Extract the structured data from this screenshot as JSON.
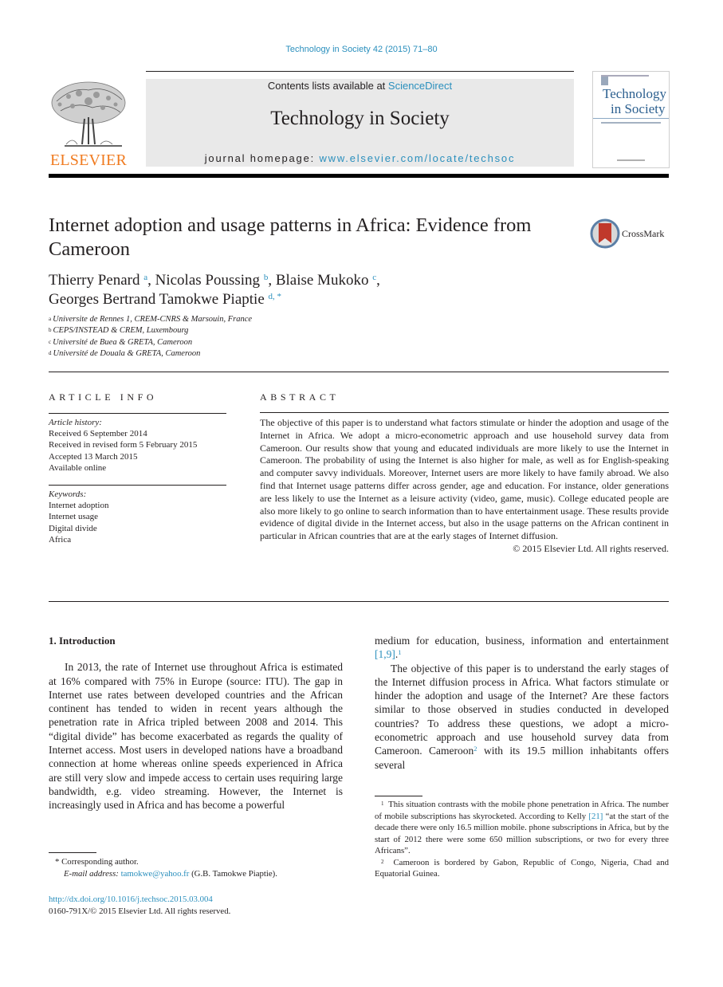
{
  "running_head": "Technology in Society 42 (2015) 71–80",
  "publisher": {
    "name": "ELSEVIER",
    "logo_icon": "elsevier-tree-logo"
  },
  "masthead": {
    "contents_prefix": "Contents lists available at ",
    "contents_link": "ScienceDirect",
    "journal_title": "Technology in Society",
    "homepage_prefix": "journal homepage: ",
    "homepage_link": "www.elsevier.com/locate/techsoc"
  },
  "cover": {
    "line1": "Technology",
    "line2": "in Society"
  },
  "article": {
    "title": "Internet adoption and usage patterns in Africa: Evidence from Cameroon",
    "crossmark_label": "CrossMark",
    "authors": [
      {
        "name": "Thierry Penard",
        "sup": "a",
        "sep": ", "
      },
      {
        "name": "Nicolas Poussing",
        "sup": "b",
        "sep": ", "
      },
      {
        "name": "Blaise Mukoko",
        "sup": "c",
        "sep": ","
      },
      {
        "name": "Georges Bertrand Tamokwe Piaptie",
        "sup": "d, *",
        "sep": ""
      }
    ],
    "affiliations": [
      {
        "sup": "a",
        "text": "Universite de Rennes 1, CREM-CNRS & Marsouin, France"
      },
      {
        "sup": "b",
        "text": "CEPS/INSTEAD & CREM, Luxembourg"
      },
      {
        "sup": "c",
        "text": "Université de Buea & GRETA, Cameroon"
      },
      {
        "sup": "d",
        "text": "Université de Douala & GRETA, Cameroon"
      }
    ]
  },
  "article_info": {
    "heading": "ARTICLE INFO",
    "history_label": "Article history:",
    "history": [
      "Received 6 September 2014",
      "Received in revised form 5 February 2015",
      "Accepted 13 March 2015",
      "Available online"
    ],
    "keywords_label": "Keywords:",
    "keywords": [
      "Internet adoption",
      "Internet usage",
      "Digital divide",
      "Africa"
    ]
  },
  "abstract": {
    "heading": "ABSTRACT",
    "text": "The objective of this paper is to understand what factors stimulate or hinder the adoption and usage of the Internet in Africa. We adopt a micro-econometric approach and use household survey data from Cameroon. Our results show that young and educated individuals are more likely to use the Internet in Cameroon. The probability of using the Internet is also higher for male, as well as for English-speaking and computer savvy individuals. Moreover, Internet users are more likely to have family abroad. We also find that Internet usage patterns differ across gender, age and education. For instance, older generations are less likely to use the Internet as a leisure activity (video, game, music). College educated people are also more likely to go online to search in­formation than to have entertainment usage. These results provide evidence of digital divide in the Internet access, but also in the usage patterns on the African continent in particular in African countries that are at the early stages of Internet diffusion.",
    "copyright": "© 2015 Elsevier Ltd. All rights reserved."
  },
  "intro": {
    "heading": "1.  Introduction",
    "p1": "In 2013, the rate of Internet use throughout Africa is estimated at 16% compared with 75% in Europe (source: ITU). The gap in Internet use rates between developed countries and the African continent has tended to widen in recent years although the penetration rate in Africa tripled between 2008 and 2014. This “digital divide” has become exacerbated as regards the quality of Internet access. Most users in developed nations have a broadband connection at home whereas online speeds experienced in Africa are still very slow and impede access to certain uses requiring large bandwidth, e.g. video streaming. However, the Internet is increasingly used in Africa and has become a powerful",
    "p1_cont": "medium for education, business, information and enter­tainment ",
    "p1_ref": "[1,9]",
    "p1_end": ".",
    "p1_fn": "1",
    "p2_a": "The objective of this paper is to understand the early stages of the Internet diffusion process in Africa. What factors stimulate or hinder the adoption and usage of the Internet? Are these factors similar to those observed in studies conducted in developed countries? To address these questions, we adopt a micro-econometric approach and use household survey data from Cameroon. Cameroon",
    "p2_fn": "2",
    "p2_b": " with its 19.5 million inhabitants offers several"
  },
  "footnotes": {
    "corresponding": "Corresponding author.",
    "email_label": "E-mail address: ",
    "email": "tamokwe@yahoo.fr",
    "email_suffix": " (G.B. Tamokwe Piaptie).",
    "doi": "http://dx.doi.org/10.1016/j.techsoc.2015.03.004",
    "issn": "0160-791X/© 2015 Elsevier Ltd. All rights reserved.",
    "fn1_num": "1",
    "fn1_a": "This situation contrasts with the mobile phone penetration in Africa. The number of mobile subscriptions has skyrocketed. According to Kelly ",
    "fn1_ref": "[21]",
    "fn1_b": " “at the start of the decade there were only 16.5 million mobile. phone subscriptions in Africa, but by the start of 2012 there were some 650 million subscriptions, or two for every three Africans”.",
    "fn2_num": "2",
    "fn2": "Cameroon is bordered by Gabon, Republic of Congo, Nigeria, Chad and Equatorial Guinea."
  }
}
